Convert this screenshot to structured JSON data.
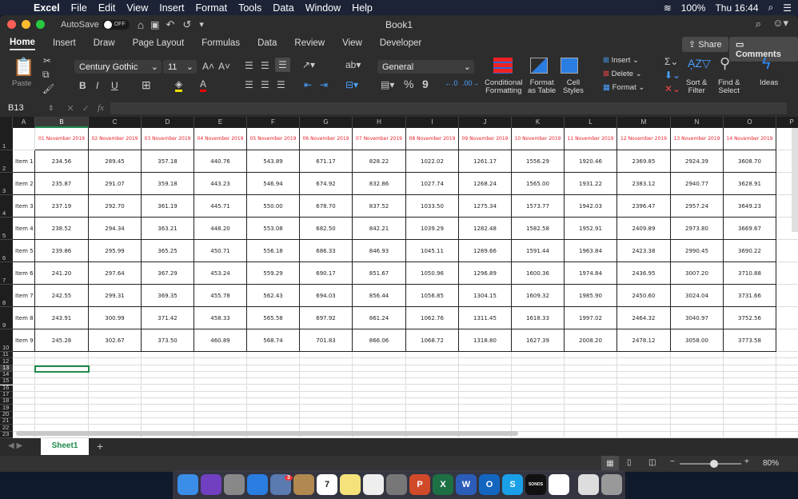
{
  "menubar": {
    "app": "Excel",
    "items": [
      "File",
      "Edit",
      "View",
      "Insert",
      "Format",
      "Tools",
      "Data",
      "Window",
      "Help"
    ],
    "battery": "100%",
    "clock": "Thu 16:44"
  },
  "titlebar": {
    "autosave": "AutoSave",
    "toggle": "OFF",
    "title": "Book1"
  },
  "tabs": [
    "Home",
    "Insert",
    "Draw",
    "Page Layout",
    "Formulas",
    "Data",
    "Review",
    "View",
    "Developer"
  ],
  "active_tab": "Home",
  "share": "Share",
  "comments": "Comments",
  "ribbon": {
    "paste": "Paste",
    "font": "Century Gothic",
    "size": "11",
    "number_format": "General",
    "conditional": [
      "Conditional",
      "Formatting"
    ],
    "format_table": [
      "Format",
      "as Table"
    ],
    "cell_styles": [
      "Cell",
      "Styles"
    ],
    "insert": "Insert",
    "delete": "Delete",
    "format": "Format",
    "sort": [
      "Sort &",
      "Filter"
    ],
    "find": [
      "Find &",
      "Select"
    ],
    "ideas": "Ideas",
    "bold": "B",
    "italic": "I",
    "underline": "U",
    "percent": "%",
    "comma": "9"
  },
  "formula_bar": {
    "name_box": "B13",
    "fx": "fx",
    "value": ""
  },
  "columns": [
    "A",
    "B",
    "C",
    "D",
    "E",
    "F",
    "G",
    "H",
    "I",
    "J",
    "K",
    "L",
    "M",
    "N",
    "O",
    "P"
  ],
  "selected_cell": "B13",
  "sheet": {
    "dates": [
      "01 November 2019",
      "02 November 2019",
      "03 November 2019",
      "04 November 2019",
      "05 November 2019",
      "06 November 2019",
      "07 November 2019",
      "08 November 2019",
      "09 November 2019",
      "10 November 2019",
      "11 November 2019",
      "12 November 2019",
      "13 November 2019",
      "14 November 2019"
    ],
    "rows": [
      {
        "label": "Item 1",
        "values": [
          "234.56",
          "289.45",
          "357.18",
          "440.76",
          "543.89",
          "671.17",
          "828.22",
          "1022.02",
          "1261.17",
          "1556.29",
          "1920.46",
          "2369.85",
          "2924.39",
          "3608.70"
        ]
      },
      {
        "label": "Item 2",
        "values": [
          "235.87",
          "291.07",
          "359.18",
          "443.23",
          "546.94",
          "674.92",
          "832.86",
          "1027.74",
          "1268.24",
          "1565.00",
          "1931.22",
          "2383.12",
          "2940.77",
          "3628.91"
        ]
      },
      {
        "label": "Item 3",
        "values": [
          "237.19",
          "292.70",
          "361.19",
          "445.71",
          "550.00",
          "678.70",
          "837.52",
          "1033.50",
          "1275.34",
          "1573.77",
          "1942.03",
          "2396.47",
          "2957.24",
          "3649.23"
        ]
      },
      {
        "label": "Item 4",
        "values": [
          "238.52",
          "294.34",
          "363.21",
          "448.20",
          "553.08",
          "682.50",
          "842.21",
          "1039.29",
          "1282.48",
          "1582.58",
          "1952.91",
          "2409.89",
          "2973.80",
          "3669.67"
        ]
      },
      {
        "label": "Item 5",
        "values": [
          "239.86",
          "295.99",
          "365.25",
          "450.71",
          "556.18",
          "686.33",
          "846.93",
          "1045.11",
          "1289.66",
          "1591.44",
          "1963.84",
          "2423.38",
          "2990.45",
          "3690.22"
        ]
      },
      {
        "label": "Item 6",
        "values": [
          "241.20",
          "297.64",
          "367.29",
          "453.24",
          "559.29",
          "690.17",
          "851.67",
          "1050.96",
          "1296.89",
          "1600.36",
          "1974.84",
          "2436.95",
          "3007.20",
          "3710.88"
        ]
      },
      {
        "label": "Item 7",
        "values": [
          "242.55",
          "299.31",
          "369.35",
          "455.78",
          "562.43",
          "694.03",
          "856.44",
          "1056.85",
          "1304.15",
          "1609.32",
          "1985.90",
          "2450.60",
          "3024.04",
          "3731.66"
        ]
      },
      {
        "label": "Item 8",
        "values": [
          "243.91",
          "300.99",
          "371.42",
          "458.33",
          "565.58",
          "697.92",
          "861.24",
          "1062.76",
          "1311.45",
          "1618.33",
          "1997.02",
          "2464.32",
          "3040.97",
          "3752.56"
        ]
      },
      {
        "label": "Item 9",
        "values": [
          "245.28",
          "302.67",
          "373.50",
          "460.89",
          "568.74",
          "701.83",
          "866.06",
          "1068.72",
          "1318.80",
          "1627.39",
          "2008.20",
          "2478.12",
          "3058.00",
          "3773.58"
        ]
      }
    ]
  },
  "sheet_tabs": [
    "Sheet1"
  ],
  "zoom": "80%",
  "zoom_level": 0.8,
  "dock": [
    "Finder",
    "Siri",
    "Launchpad",
    "Safari",
    "Mail",
    "Contacts",
    "Calendar",
    "Notes",
    "Photos",
    "System Preferences",
    "PowerPoint",
    "Excel",
    "Word",
    "Outlook",
    "Skype",
    "SONOS",
    "Notability",
    "Preview",
    "Trash"
  ],
  "dock_badge": "3",
  "calendar_day": "7",
  "colors": {
    "accent": "#1f8a4c",
    "header_red": "#e8202a"
  }
}
